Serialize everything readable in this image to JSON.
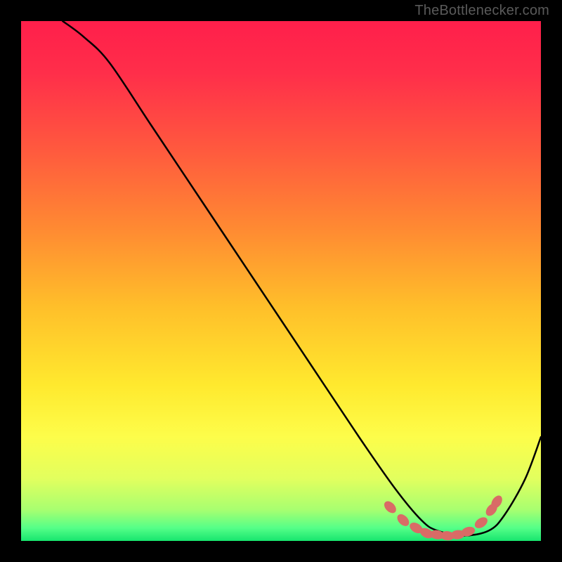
{
  "watermark": "TheBottlenecker.com",
  "chart_data": {
    "type": "line",
    "title": "",
    "xlabel": "",
    "ylabel": "",
    "xlim": [
      0,
      100
    ],
    "ylim": [
      0,
      100
    ],
    "grid": false,
    "series": [
      {
        "name": "curve",
        "x": [
          8,
          12,
          17,
          25,
          35,
          45,
          55,
          65,
          72,
          77,
          80,
          85,
          90,
          93,
          97,
          100
        ],
        "y": [
          100,
          97,
          92,
          80,
          65,
          50,
          35,
          20,
          10,
          4,
          2,
          1,
          2,
          5,
          12,
          20
        ]
      }
    ],
    "markers": {
      "name": "dots",
      "x": [
        71,
        73.5,
        76,
        78,
        80,
        82,
        84,
        86,
        88.5,
        90.5,
        91.5
      ],
      "y": [
        6.5,
        4.0,
        2.5,
        1.5,
        1.2,
        1.0,
        1.2,
        1.8,
        3.5,
        6.0,
        7.5
      ]
    },
    "gradient_stops": [
      {
        "offset": 0.0,
        "color": "#ff1f4b"
      },
      {
        "offset": 0.1,
        "color": "#ff2e4a"
      },
      {
        "offset": 0.25,
        "color": "#ff5a3e"
      },
      {
        "offset": 0.4,
        "color": "#ff8a32"
      },
      {
        "offset": 0.55,
        "color": "#ffbf2a"
      },
      {
        "offset": 0.7,
        "color": "#ffe92e"
      },
      {
        "offset": 0.8,
        "color": "#fdfd4a"
      },
      {
        "offset": 0.88,
        "color": "#e2ff5e"
      },
      {
        "offset": 0.94,
        "color": "#a8ff70"
      },
      {
        "offset": 0.975,
        "color": "#55ff88"
      },
      {
        "offset": 1.0,
        "color": "#17e56e"
      }
    ],
    "curve_color": "#000000",
    "marker_color": "#d96b66"
  }
}
